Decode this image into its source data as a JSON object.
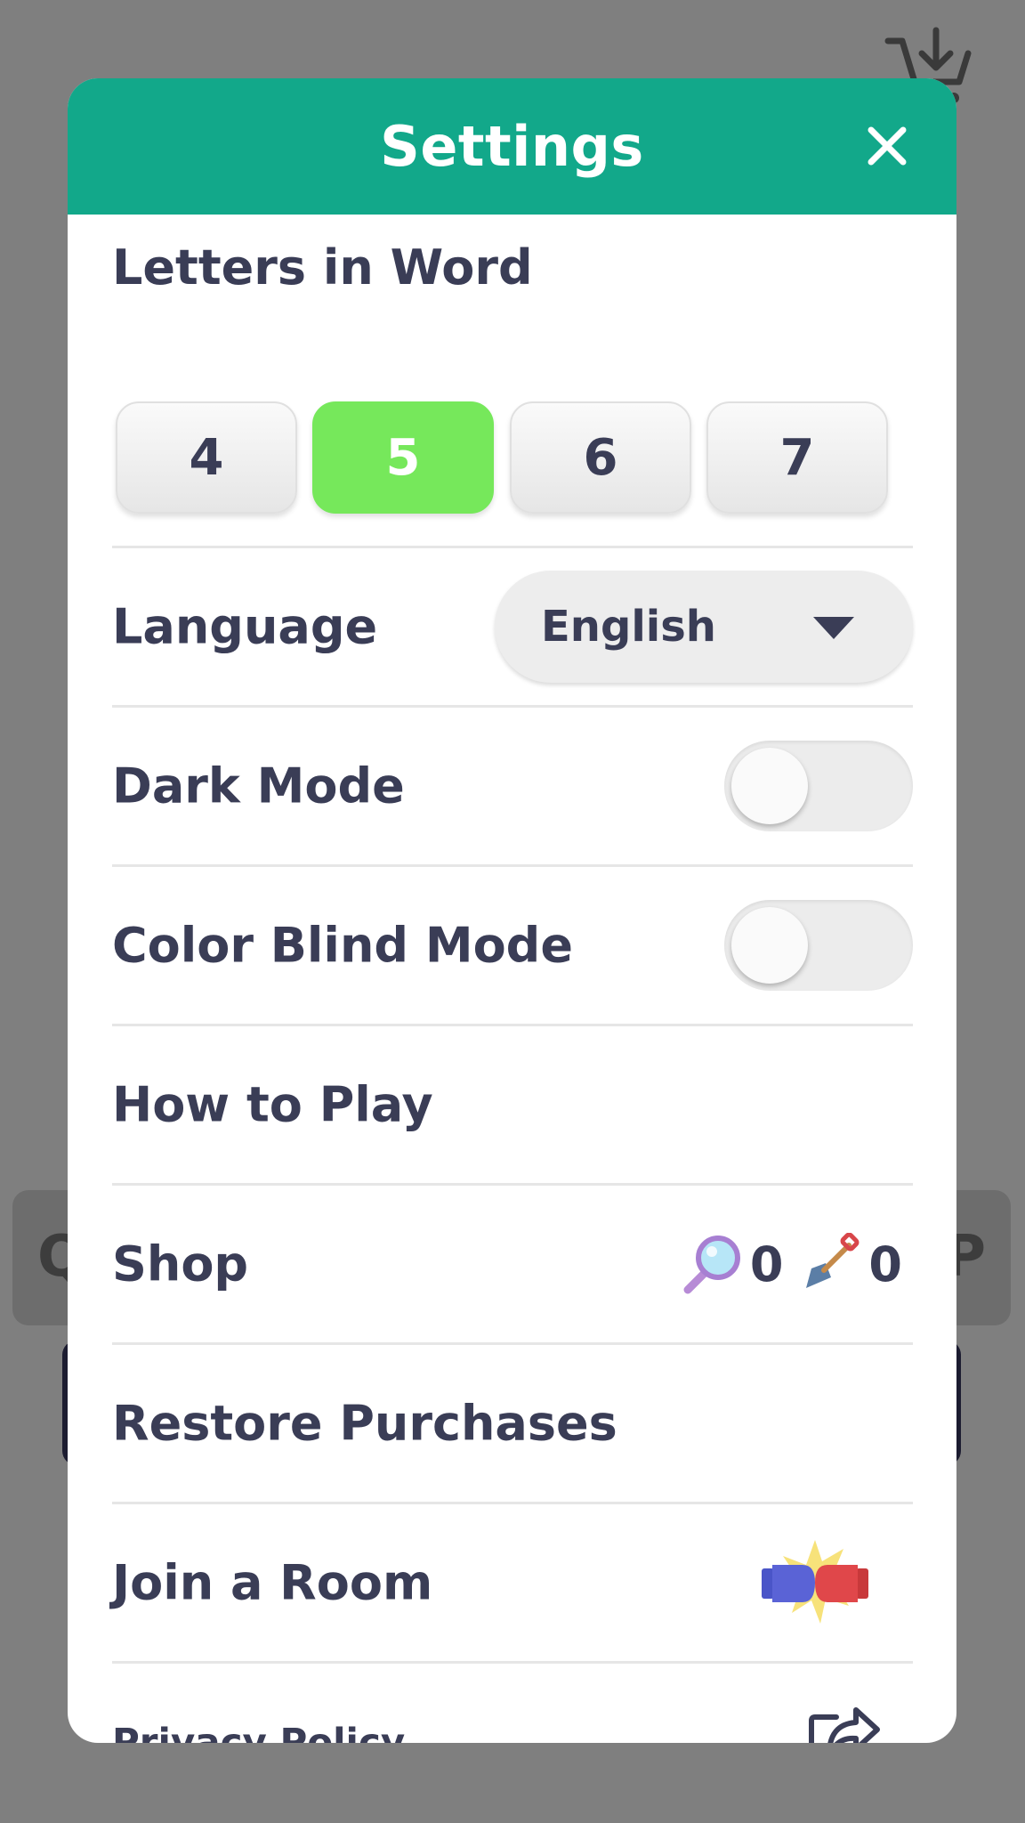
{
  "background": {
    "left_letter": "Q",
    "right_letter": "P"
  },
  "modal": {
    "title": "Settings",
    "close_icon": "close-icon"
  },
  "letters_in_word": {
    "label": "Letters in Word",
    "options": [
      "4",
      "5",
      "6",
      "7"
    ],
    "selected": "5"
  },
  "language": {
    "label": "Language",
    "value": "English"
  },
  "dark_mode": {
    "label": "Dark Mode",
    "enabled": false
  },
  "color_blind_mode": {
    "label": "Color Blind Mode",
    "enabled": false
  },
  "how_to_play": {
    "label": "How to Play"
  },
  "shop": {
    "label": "Shop",
    "magnifier_count": "0",
    "shovel_count": "0"
  },
  "restore_purchases": {
    "label": "Restore Purchases"
  },
  "join_room": {
    "label": "Join a Room",
    "icon": "boxing-gloves-icon"
  },
  "privacy_policy": {
    "label": "Privacy Policy",
    "icon": "share-icon"
  },
  "colors": {
    "header": "#12a88a",
    "selected_letter": "#76e85b",
    "text": "#3a3d56",
    "overlay": "#7f7f7f"
  }
}
